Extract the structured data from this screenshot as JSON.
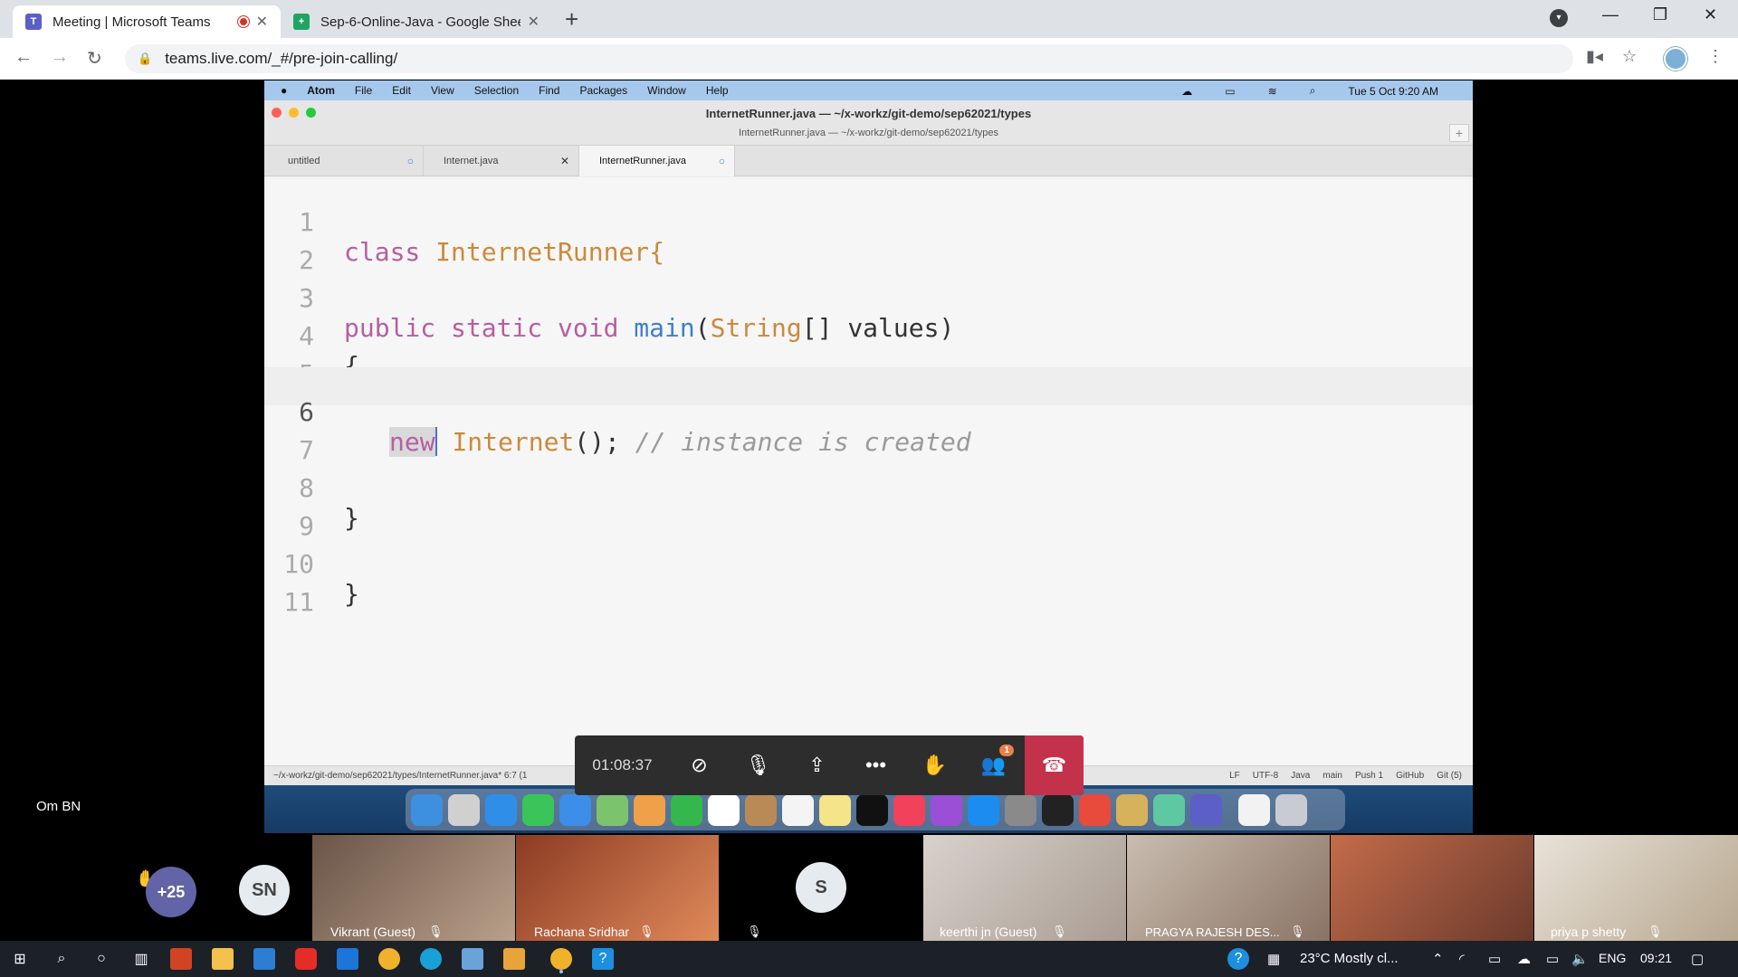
{
  "browser": {
    "tabs": [
      {
        "title": "Meeting | Microsoft Teams",
        "close": "✕"
      },
      {
        "title": "Sep-6-Online-Java - Google Shee",
        "close": "✕"
      }
    ],
    "address": "teams.live.com/_#/pre-join-calling/"
  },
  "mac": {
    "menu": [
      "Atom",
      "File",
      "Edit",
      "View",
      "Selection",
      "Find",
      "Packages",
      "Window",
      "Help"
    ],
    "clock": "Tue 5 Oct  9:20 AM",
    "title": "InternetRunner.java — ~/x-workz/git-demo/sep62021/types",
    "subtitle": "InternetRunner.java — ~/x-workz/git-demo/sep62021/types",
    "tabs": [
      "untitled",
      "Internet.java",
      "InternetRunner.java"
    ]
  },
  "editor": {
    "line_numbers": [
      "1",
      "2",
      "3",
      "4",
      "5",
      "6",
      "7",
      "8",
      "9",
      "10",
      "11"
    ],
    "l1": {
      "kw": "class",
      "name": "InternetRunner{"
    },
    "l3": {
      "mod": "public static void",
      "fn": "main",
      "open": "(",
      "type": "String",
      "rest": "[] values)"
    },
    "l4": "{",
    "l6": {
      "kw": "new",
      "type": "Internet",
      "rest": "();",
      "comment": "// instance is created"
    },
    "l8": "}",
    "l10": "}"
  },
  "statusbar": {
    "path": "~/x-workz/git-demo/sep62021/types/InternetRunner.java*   6:7   (1",
    "items": [
      "LF",
      "UTF-8",
      "Java",
      "main",
      "Push 1",
      "GitHub",
      "Git (5)"
    ]
  },
  "call": {
    "timer": "01:08:37",
    "participants_badge": "1",
    "presenter": "Om BN",
    "overflow": "+25",
    "sn": "SN",
    "s": "S",
    "names": [
      "Vikrant (Guest)",
      "Rachana Sridhar",
      "keerthi jn (Guest)",
      "PRAGYA RAJESH DES...",
      "priya p shetty"
    ]
  },
  "taskbar": {
    "weather": "23°C  Mostly cl...",
    "lang": "ENG",
    "time": "09:21"
  },
  "colors": {
    "teams_purple": "#6264a7",
    "hangup": "#c4314b",
    "editor_bg": "#f6f6f6"
  }
}
